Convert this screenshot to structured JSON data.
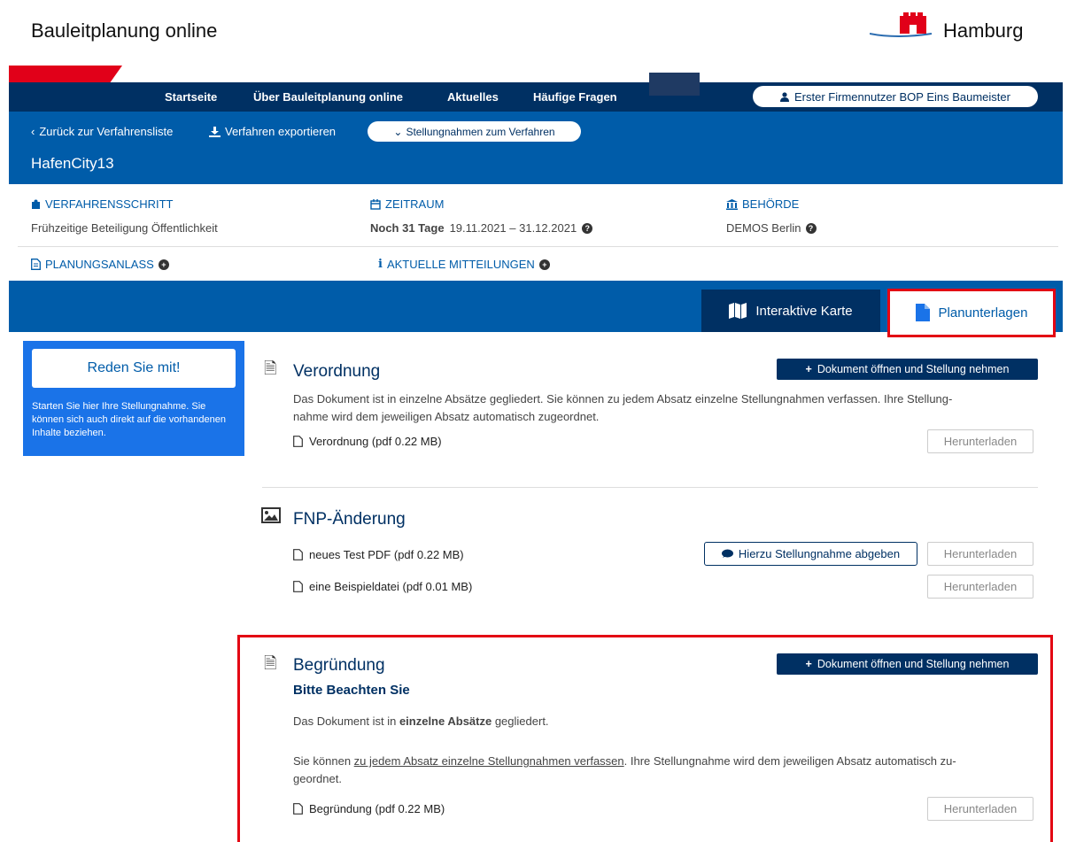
{
  "header": {
    "site_title": "Bauleitplanung online",
    "logo_text": "Hamburg"
  },
  "nav": {
    "items": [
      "Startseite",
      "Über Bauleitplanung online",
      "Aktuelles",
      "Häufige Fragen"
    ],
    "user": "Erster Firmennutzer BOP Eins Baumeister"
  },
  "verfahren": {
    "back": "Zurück zur Verfahrensliste",
    "export": "Verfahren exportieren",
    "statements": "Stellungnahmen zum Verfahren",
    "title": "HafenCity13"
  },
  "info": {
    "step_label": "VERFAHRENSSCHRITT",
    "step_value": "Frühzeitige Beteiligung Öffentlichkeit",
    "period_label": "ZEITRAUM",
    "period_remaining": "Noch 31 Tage",
    "period_range": "19.11.2021 – 31.12.2021",
    "authority_label": "BEHÖRDE",
    "authority_value": "DEMOS Berlin",
    "reason_label": "PLANUNGSANLASS",
    "news_label": "AKTUELLE MITTEILUNGEN"
  },
  "tabs": {
    "map": "Interaktive Karte",
    "docs": "Planunterlagen"
  },
  "sidebar": {
    "button": "Reden Sie mit!",
    "text": "Starten Sie hier Ihre Stellungnahme. Sie können sich auch direkt auf die vorhandenen Inhalte beziehen."
  },
  "docs": {
    "open_statement_button": "Dokument öffnen und Stellung nehmen",
    "download_button": "Herunterladen",
    "statement_button": "Hierzu Stellungnahme abgeben",
    "verordnung": {
      "title": "Verordnung",
      "desc_line1": "Das Dokument ist in einzelne Absätze gegliedert. Sie können zu jedem Absatz einzelne Stellungnahmen verfassen. Ihre Stellung-",
      "desc_line2": "nahme wird dem jeweiligen Absatz automatisch zugeordnet.",
      "file": "Verordnung (pdf 0.22 MB)"
    },
    "fnp": {
      "title": "FNP-Änderung",
      "file1": "neues Test PDF (pdf 0.22 MB)",
      "file2": "eine Beispieldatei (pdf 0.01 MB)"
    },
    "begruendung": {
      "title": "Begründung",
      "subhead": "Bitte Beachten Sie",
      "p1_a": "Das Dokument ist in ",
      "p1_b": "einzelne Absätze",
      "p1_c": " gegliedert.",
      "p2_a": "Sie können ",
      "p2_b": "zu jedem Absatz einzelne Stellungnahmen verfassen",
      "p2_c": ". Ihre Stellungnahme wird dem jeweiligen Absatz automatisch zu-",
      "p2_d": "geordnet.",
      "file": "Begründung (pdf 0.22 MB)"
    }
  },
  "colors": {
    "navy": "#003063",
    "blue": "#005ca9",
    "red": "#e10019",
    "highlight": "#e30613"
  }
}
